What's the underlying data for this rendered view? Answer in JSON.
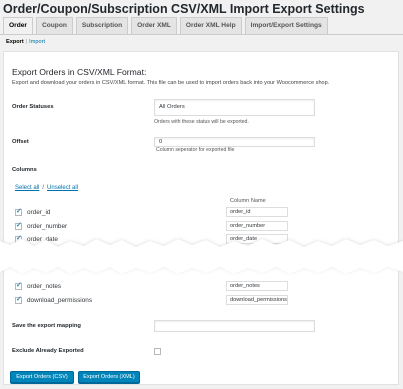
{
  "page": {
    "title": "Order/Coupon/Subscription CSV/XML Import Export Settings"
  },
  "tabs": [
    {
      "label": "Order",
      "active": true
    },
    {
      "label": "Coupon",
      "active": false
    },
    {
      "label": "Subscription",
      "active": false
    },
    {
      "label": "Order XML",
      "active": false
    },
    {
      "label": "Order XML Help",
      "active": false
    },
    {
      "label": "Import/Export Settings",
      "active": false
    }
  ],
  "subnav": {
    "current": "Export",
    "separator": "|",
    "link": "Import"
  },
  "export": {
    "heading": "Export Orders in CSV/XML Format:",
    "description": "Export and download your orders in CSV/XML format. This file can be used to import orders back into your Woocommerce shop.",
    "order_statuses": {
      "label": "Order Statuses",
      "value": "All Orders",
      "help": "Orders with these status will be exported."
    },
    "offset": {
      "label": "Offset",
      "value": "0",
      "help": "Column seperator for exported file"
    },
    "columns": {
      "label": "Columns",
      "select_all": "Select all",
      "slash": "/",
      "unselect_all": "Unselect all",
      "column_name_header": "Column Name",
      "rows_top": [
        {
          "field": "order_id",
          "column_name": "order_id",
          "checked": true
        },
        {
          "field": "order_number",
          "column_name": "order_number",
          "checked": true
        },
        {
          "field": "order_date",
          "column_name": "order_date",
          "checked": true
        }
      ],
      "rows_bottom": [
        {
          "field": "order_notes",
          "column_name": "order_notes",
          "checked": true
        },
        {
          "field": "download_permissions",
          "column_name": "download_permissions",
          "checked": true
        }
      ]
    },
    "save_mapping": {
      "label": "Save the export mapping",
      "value": ""
    },
    "exclude_exported": {
      "label": "Exclude Already Exported",
      "checked": false
    },
    "buttons": {
      "csv": "Export Orders (CSV)",
      "xml": "Export Orders (XML)"
    }
  },
  "colors": {
    "accent": "#0085ba",
    "link": "#0073aa",
    "checkmark": "#1e8cbe"
  },
  "icons": {
    "checkbox_checked": "checkmark-icon"
  }
}
